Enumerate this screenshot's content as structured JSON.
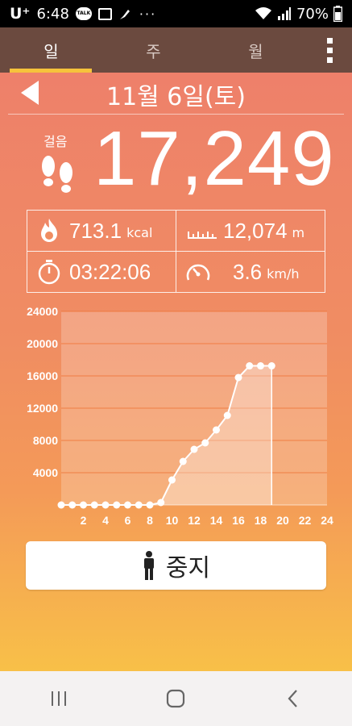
{
  "status": {
    "carrier": "U⁺",
    "time": "6:48",
    "battery": "70%",
    "more": "···"
  },
  "tabs": [
    {
      "label": "일",
      "active": true
    },
    {
      "label": "주",
      "active": false
    },
    {
      "label": "월",
      "active": false
    }
  ],
  "header": {
    "date": "11월 6일(토)"
  },
  "summary": {
    "steps_label": "걸음",
    "steps": "17,249",
    "calories": "713.1",
    "calories_unit": "kcal",
    "distance": "12,074",
    "distance_unit": "m",
    "duration": "03:22:06",
    "speed": "3.6",
    "speed_unit": "km/h"
  },
  "chart_data": {
    "type": "area",
    "x": [
      0,
      1,
      2,
      3,
      4,
      5,
      6,
      7,
      8,
      9,
      10,
      11,
      12,
      13,
      14,
      15,
      16,
      17,
      18,
      19
    ],
    "values": [
      0,
      0,
      0,
      0,
      0,
      0,
      0,
      0,
      0,
      300,
      3100,
      5400,
      6900,
      7700,
      9300,
      11100,
      15800,
      17249,
      17249,
      17249
    ],
    "xticks": [
      "2",
      "4",
      "6",
      "8",
      "10",
      "12",
      "14",
      "16",
      "18",
      "20",
      "22",
      "24"
    ],
    "yticks": [
      "4000",
      "8000",
      "12000",
      "16000",
      "20000",
      "24000"
    ],
    "xlim": [
      0,
      24
    ],
    "ylim": [
      0,
      24000
    ],
    "grid": true
  },
  "actions": {
    "stop_label": "중지"
  },
  "colors": {
    "tab_bg": "#6b4a3f",
    "tab_indicator": "#f6c33b"
  }
}
